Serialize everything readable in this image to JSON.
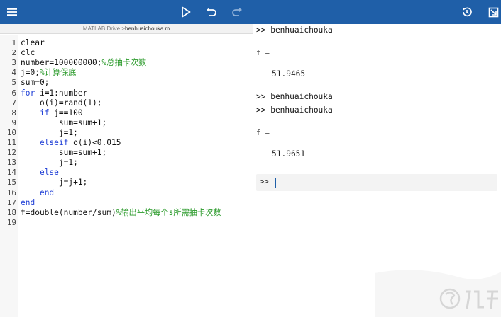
{
  "toolbar": {
    "colors": {
      "background": "#1f5fa8",
      "icon": "#ffffff",
      "disabled_icon": "#8fb0d8"
    },
    "icons": [
      "menu-icon",
      "run-icon",
      "undo-icon",
      "redo-icon",
      "history-icon",
      "open-in-new-icon"
    ]
  },
  "editor": {
    "path_prefix": "MATLAB Drive > ",
    "file_name": "benhuaichouka.m",
    "lines": [
      {
        "num": "1",
        "parts": [
          {
            "t": "clear",
            "c": "plain"
          }
        ]
      },
      {
        "num": "2",
        "parts": [
          {
            "t": "clc",
            "c": "plain"
          }
        ]
      },
      {
        "num": "3",
        "parts": [
          {
            "t": "number=100000000;",
            "c": "plain"
          },
          {
            "t": "%总抽卡次数",
            "c": "comment"
          }
        ]
      },
      {
        "num": "4",
        "parts": [
          {
            "t": "j=0;",
            "c": "plain"
          },
          {
            "t": "%计算保底",
            "c": "comment"
          }
        ]
      },
      {
        "num": "5",
        "parts": [
          {
            "t": "sum=0;",
            "c": "plain"
          }
        ]
      },
      {
        "num": "6",
        "parts": [
          {
            "t": "for",
            "c": "keyword"
          },
          {
            "t": " i=1:number",
            "c": "plain"
          }
        ]
      },
      {
        "num": "7",
        "parts": [
          {
            "t": "    o(i)=rand(1);",
            "c": "plain"
          }
        ]
      },
      {
        "num": "8",
        "parts": [
          {
            "t": "    ",
            "c": "plain"
          },
          {
            "t": "if",
            "c": "keyword"
          },
          {
            "t": " j==100",
            "c": "plain"
          }
        ]
      },
      {
        "num": "9",
        "parts": [
          {
            "t": "        sum=sum+1;",
            "c": "plain"
          }
        ]
      },
      {
        "num": "10",
        "parts": [
          {
            "t": "        j=1;",
            "c": "plain"
          }
        ]
      },
      {
        "num": "11",
        "parts": [
          {
            "t": "    ",
            "c": "plain"
          },
          {
            "t": "elseif",
            "c": "keyword"
          },
          {
            "t": " o(i)<0.015",
            "c": "plain"
          }
        ]
      },
      {
        "num": "12",
        "parts": [
          {
            "t": "        sum=sum+1;",
            "c": "plain"
          }
        ]
      },
      {
        "num": "13",
        "parts": [
          {
            "t": "        j=1;",
            "c": "plain"
          }
        ]
      },
      {
        "num": "14",
        "parts": [
          {
            "t": "    ",
            "c": "plain"
          },
          {
            "t": "else",
            "c": "keyword"
          }
        ]
      },
      {
        "num": "15",
        "parts": [
          {
            "t": "        j=j+1;",
            "c": "plain"
          }
        ]
      },
      {
        "num": "16",
        "parts": [
          {
            "t": "    ",
            "c": "plain"
          },
          {
            "t": "end",
            "c": "keyword"
          }
        ]
      },
      {
        "num": "17",
        "parts": [
          {
            "t": "end",
            "c": "keyword"
          }
        ]
      },
      {
        "num": "18",
        "parts": [
          {
            "t": "f=double(number/sum)",
            "c": "plain"
          },
          {
            "t": "%输出平均每个s所需抽卡次数",
            "c": "comment"
          }
        ]
      },
      {
        "num": "19",
        "parts": []
      }
    ]
  },
  "console": {
    "cmd1": ">> benhuaichouka",
    "var1": "f =",
    "val1": "51.9465",
    "cmd2": ">> benhuaichouka",
    "cmd3": ">> benhuaichouka",
    "var2": "f =",
    "val2": "51.9651",
    "prompt": ">>"
  },
  "colors": {
    "keyword": "#1f3fd6",
    "comment": "#2a9a2a",
    "text": "#111111"
  }
}
